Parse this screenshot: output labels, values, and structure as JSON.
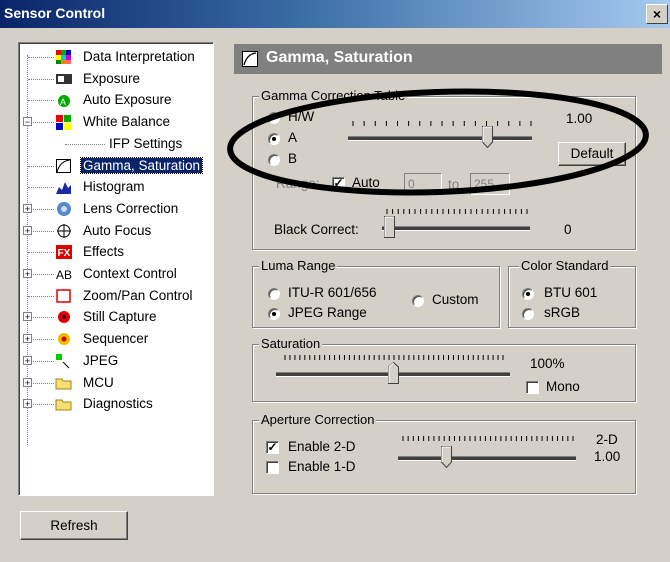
{
  "window": {
    "title": "Sensor Control",
    "close": "×"
  },
  "tree": {
    "items": [
      {
        "label": "Data Interpretation",
        "icon": "color-grid-icon",
        "expander": ""
      },
      {
        "label": "Exposure",
        "icon": "exposure-icon",
        "expander": ""
      },
      {
        "label": "Auto Exposure",
        "icon": "auto-exposure-icon",
        "expander": ""
      },
      {
        "label": "White Balance",
        "icon": "white-balance-icon",
        "expander": "−"
      },
      {
        "label": "IFP Settings",
        "icon": "",
        "expander": ""
      },
      {
        "label": "Gamma, Saturation",
        "icon": "gamma-curve-icon",
        "expander": "",
        "selected": true
      },
      {
        "label": "Histogram",
        "icon": "histogram-icon",
        "expander": ""
      },
      {
        "label": "Lens Correction",
        "icon": "lens-icon",
        "expander": "+"
      },
      {
        "label": "Auto Focus",
        "icon": "focus-icon",
        "expander": "+"
      },
      {
        "label": "Effects",
        "icon": "fx-icon",
        "expander": ""
      },
      {
        "label": "Context Control",
        "icon": "ab-icon",
        "expander": "+"
      },
      {
        "label": "Zoom/Pan Control",
        "icon": "zoom-icon",
        "expander": ""
      },
      {
        "label": "Still Capture",
        "icon": "capture-icon",
        "expander": "+"
      },
      {
        "label": "Sequencer",
        "icon": "sequencer-icon",
        "expander": "+"
      },
      {
        "label": "JPEG",
        "icon": "jpeg-icon",
        "expander": "+"
      },
      {
        "label": "MCU",
        "icon": "folder-icon",
        "expander": "+"
      },
      {
        "label": "Diagnostics",
        "icon": "folder-icon",
        "expander": "+"
      }
    ]
  },
  "refresh_label": "Refresh",
  "panel": {
    "title": "Gamma, Saturation",
    "gamma_group": {
      "label": "Gamma Correction Table",
      "options": [
        "H/W",
        "A",
        "B"
      ],
      "selected": "A",
      "value": "1.00",
      "slider_level": 0.78,
      "default_label": "Default",
      "range_label": "Range:",
      "auto_label": "Auto",
      "auto_checked": true,
      "range_from": "0",
      "range_to_label": "to",
      "range_to": "255",
      "black_correct_label": "Black Correct:",
      "black_correct_value": "0",
      "black_correct_level": 0.0
    },
    "luma_group": {
      "label": "Luma Range",
      "options": [
        "ITU-R 601/656",
        "JPEG Range",
        "Custom"
      ],
      "selected": "JPEG Range"
    },
    "color_group": {
      "label": "Color Standard",
      "options": [
        "BTU 601",
        "sRGB"
      ],
      "selected": "BTU 601"
    },
    "saturation_group": {
      "label": "Saturation",
      "value": "100%",
      "slider_level": 0.5,
      "mono_label": "Mono",
      "mono_checked": false
    },
    "aperture_group": {
      "label": "Aperture Correction",
      "enable2d_label": "Enable 2-D",
      "enable2d_checked": true,
      "enable1d_label": "Enable 1-D",
      "enable1d_checked": false,
      "mode": "2-D",
      "value": "1.00",
      "slider_level": 0.25
    }
  },
  "colors": {
    "selection": "#0a246a",
    "face": "#d4d0c8",
    "annotation_ellipse": "#000000"
  }
}
